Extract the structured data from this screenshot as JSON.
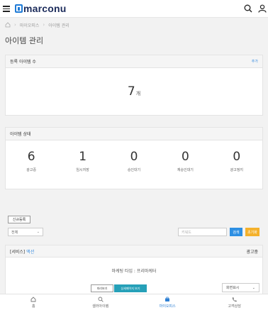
{
  "header": {
    "logo_text": "marconu",
    "icons": [
      "menu-icon",
      "search-icon",
      "user-icon"
    ]
  },
  "breadcrumb": {
    "items": [
      "마이오피스",
      "아이템 관리"
    ]
  },
  "page_title": "아이템 관리",
  "registered": {
    "title": "등록 아이템 수",
    "add_link": "추가",
    "count": "7",
    "unit": "개"
  },
  "status": {
    "title": "아이템 상태",
    "items": [
      {
        "value": "6",
        "label": "광고중"
      },
      {
        "value": "1",
        "label": "임시저장"
      },
      {
        "value": "0",
        "label": "승인대기"
      },
      {
        "value": "0",
        "label": "재승인대기"
      },
      {
        "value": "0",
        "label": "광고정지"
      }
    ]
  },
  "actions": {
    "new_button": "신규등록",
    "filter_selected": "전체",
    "keyword_placeholder": "키워드",
    "search_button": "검색",
    "reset_button": "초기화"
  },
  "item": {
    "category": "[서비스]",
    "name": "액션",
    "status": "광고중",
    "marketing_type": "마케팅 타입 : 프리마케터",
    "preview_button": "미리보기",
    "detail_page_button": "상세페이지 보기",
    "view_select": "화면표시"
  },
  "bottom_nav": {
    "home": "홈",
    "cellar_item": "셀러아이템",
    "my_office": "마이오피스",
    "customer_service": "고객상담"
  },
  "colors": {
    "accent": "#2d8fe3",
    "reset": "#f4b12c",
    "detail": "#26a0b8"
  }
}
